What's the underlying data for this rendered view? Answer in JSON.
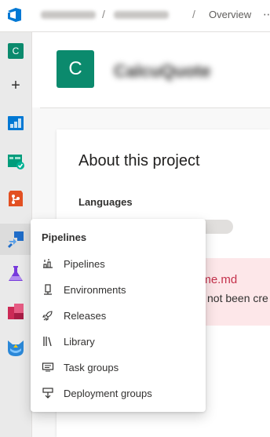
{
  "header": {
    "breadcrumb_current": "Overview",
    "separator": "/",
    "more": "⋯"
  },
  "project": {
    "initial": "C",
    "name": "CalcuQuote",
    "avatar_color": "#0b8a6d"
  },
  "about": {
    "title": "About this project",
    "languages_label": "Languages"
  },
  "readme": {
    "name_fragment": "dme.md",
    "message_fragment": "not been cre"
  },
  "flyout": {
    "title": "Pipelines",
    "items": [
      {
        "label": "Pipelines",
        "icon": "pipelines-icon"
      },
      {
        "label": "Environments",
        "icon": "environments-icon"
      },
      {
        "label": "Releases",
        "icon": "releases-icon"
      },
      {
        "label": "Library",
        "icon": "library-icon"
      },
      {
        "label": "Task groups",
        "icon": "task-groups-icon"
      },
      {
        "label": "Deployment groups",
        "icon": "deployment-groups-icon"
      }
    ]
  },
  "leftnav": {
    "plus": "+",
    "items": [
      "boards-icon",
      "test-plans-icon",
      "repos-icon",
      "pipelines-icon",
      "test-plans-flask-icon",
      "artifacts-icon",
      "extension-cat-icon"
    ]
  },
  "colors": {
    "accent": "#0078d4",
    "error_text": "#c4314b",
    "error_bg": "#fde7e9"
  }
}
